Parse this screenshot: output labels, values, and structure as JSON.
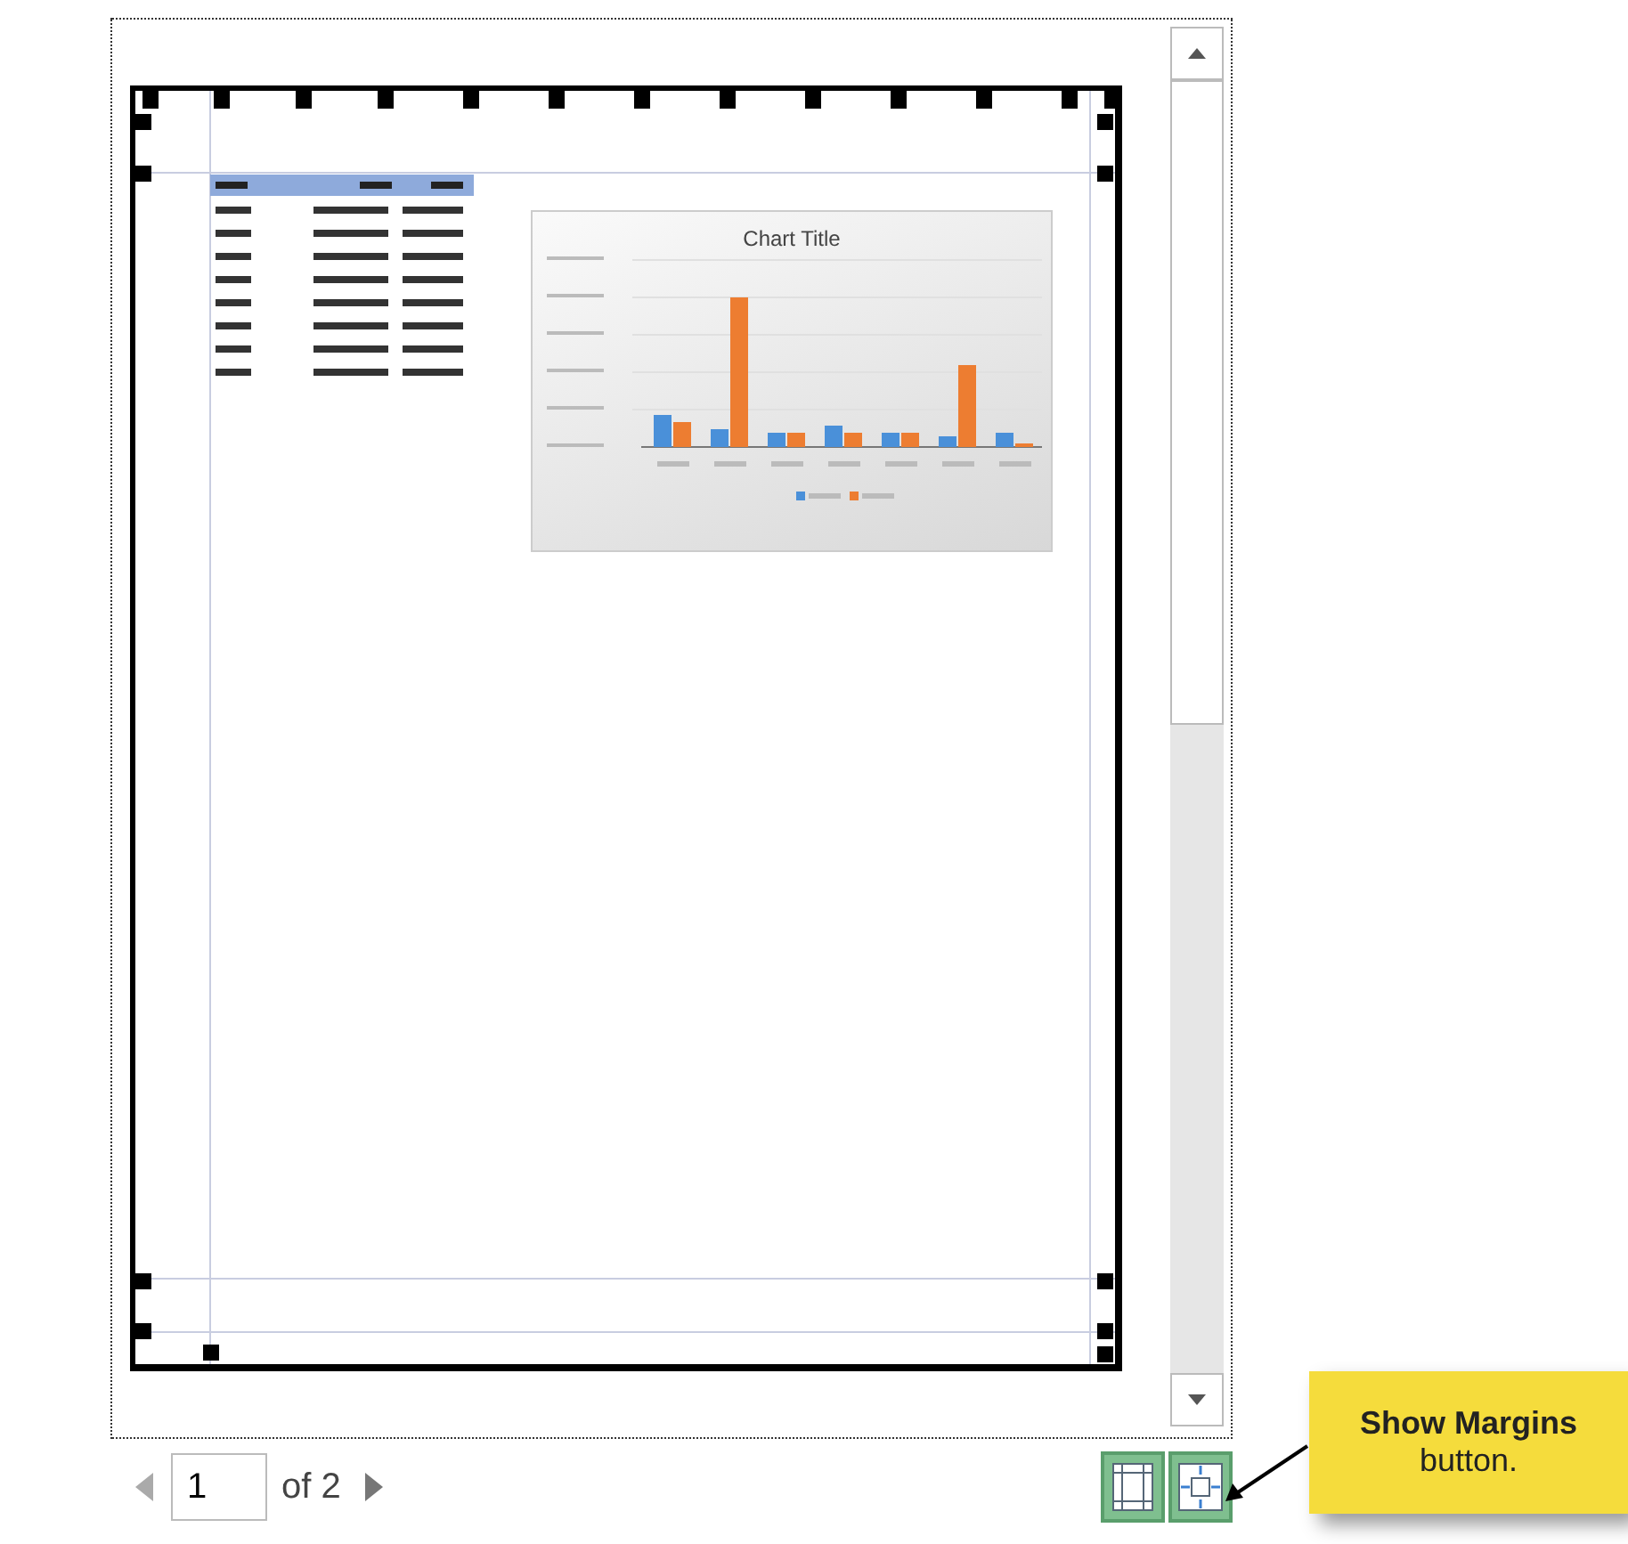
{
  "preview": {
    "chart_title": "Chart Title"
  },
  "pager": {
    "page": "1",
    "of_label": "of 2"
  },
  "view_buttons": [
    {
      "kind": "margins"
    },
    {
      "kind": "zoom"
    }
  ],
  "callout": {
    "title": "Show Margins",
    "text": "button."
  }
}
